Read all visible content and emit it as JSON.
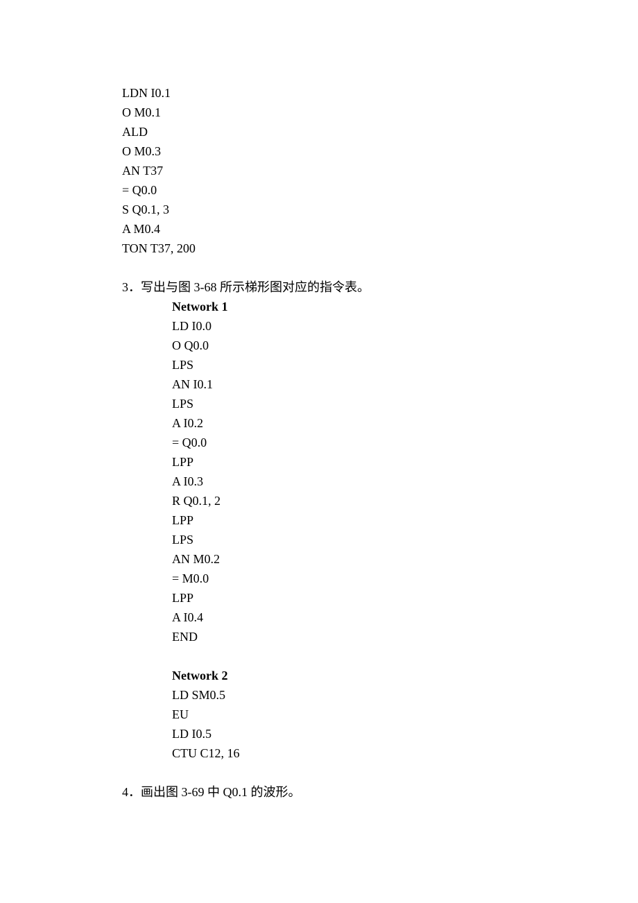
{
  "block1": {
    "lines": [
      "LDN I0.1",
      "O M0.1",
      "ALD",
      "O M0.3",
      "AN T37",
      "= Q0.0",
      "S Q0.1, 3",
      "A M0.4",
      "TON T37, 200"
    ]
  },
  "q3": {
    "heading": "3．写出与图 3-68 所示梯形图对应的指令表。",
    "network1_title": "Network 1",
    "network1_lines": [
      "LD I0.0",
      "O Q0.0",
      "LPS",
      "AN I0.1",
      "LPS",
      "A I0.2",
      "= Q0.0",
      "LPP",
      "A I0.3",
      "R Q0.1, 2",
      "LPP",
      "LPS",
      "AN M0.2",
      "= M0.0",
      "LPP",
      "A I0.4",
      "END"
    ],
    "network2_title": "Network 2",
    "network2_lines": [
      "LD SM0.5",
      "EU",
      "LD I0.5",
      "CTU C12, 16"
    ]
  },
  "q4": {
    "heading": "4．画出图 3-69 中 Q0.1 的波形。"
  }
}
